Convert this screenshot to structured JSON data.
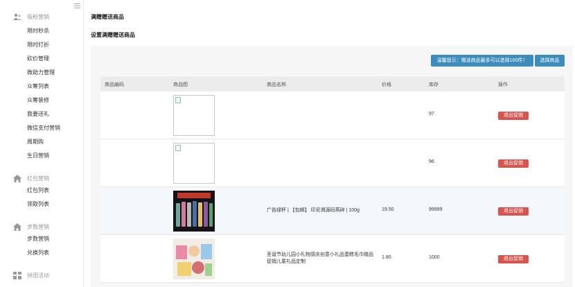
{
  "sidebar": {
    "groups": [
      {
        "label": "吸粉营销",
        "icon": "users-icon",
        "items": [
          "限时秒杀",
          "限时打折",
          "砍价管理",
          "微助力管理",
          "众筹列表",
          "众筹装修",
          "我要送礼",
          "微信支付营销",
          "周期购",
          "生日营销"
        ]
      },
      {
        "label": "红包营销",
        "icon": "home-icon",
        "items": [
          "红包列表",
          "领取列表"
        ]
      },
      {
        "label": "步数营销",
        "icon": "home-icon",
        "items": [
          "步数营销",
          "兑换列表"
        ]
      },
      {
        "label": "拼团活动",
        "icon": "grid-icon",
        "items": []
      }
    ]
  },
  "page": {
    "title": "满赠赠送商品",
    "section_title": "设置满赠赠送商品",
    "tip_button": "温馨提示：赠送商品最多可以选择100件！",
    "select_button": "选择商品"
  },
  "table": {
    "headers": [
      "商品编码",
      "商品图",
      "商品名称",
      "价格",
      "库存",
      "操作"
    ],
    "rows": [
      {
        "code": "",
        "image": "broken",
        "name": "",
        "price": "",
        "stock": "97",
        "action": "退出促销"
      },
      {
        "code": "",
        "image": "broken",
        "name": "",
        "price": "",
        "stock": "96",
        "action": "退出促销"
      },
      {
        "code": "",
        "image": "product-tumbler",
        "name": "广告绿杯 | 【包邮】 印尼溯源码燕碎 | 100g",
        "price": "19.50",
        "stock": "99999",
        "action": "退出促销"
      },
      {
        "code": "",
        "image": "product-toys",
        "name": "圣诞节幼儿园小礼物感庆创意小礼品蛋糕毛巾赠品促销儿童礼品定制",
        "price": "1.80",
        "stock": "1000",
        "action": "退出促销"
      }
    ]
  },
  "colors": {
    "primary": "#3c8dbc",
    "danger": "#d9534f",
    "panel": "#f6f6f6"
  }
}
